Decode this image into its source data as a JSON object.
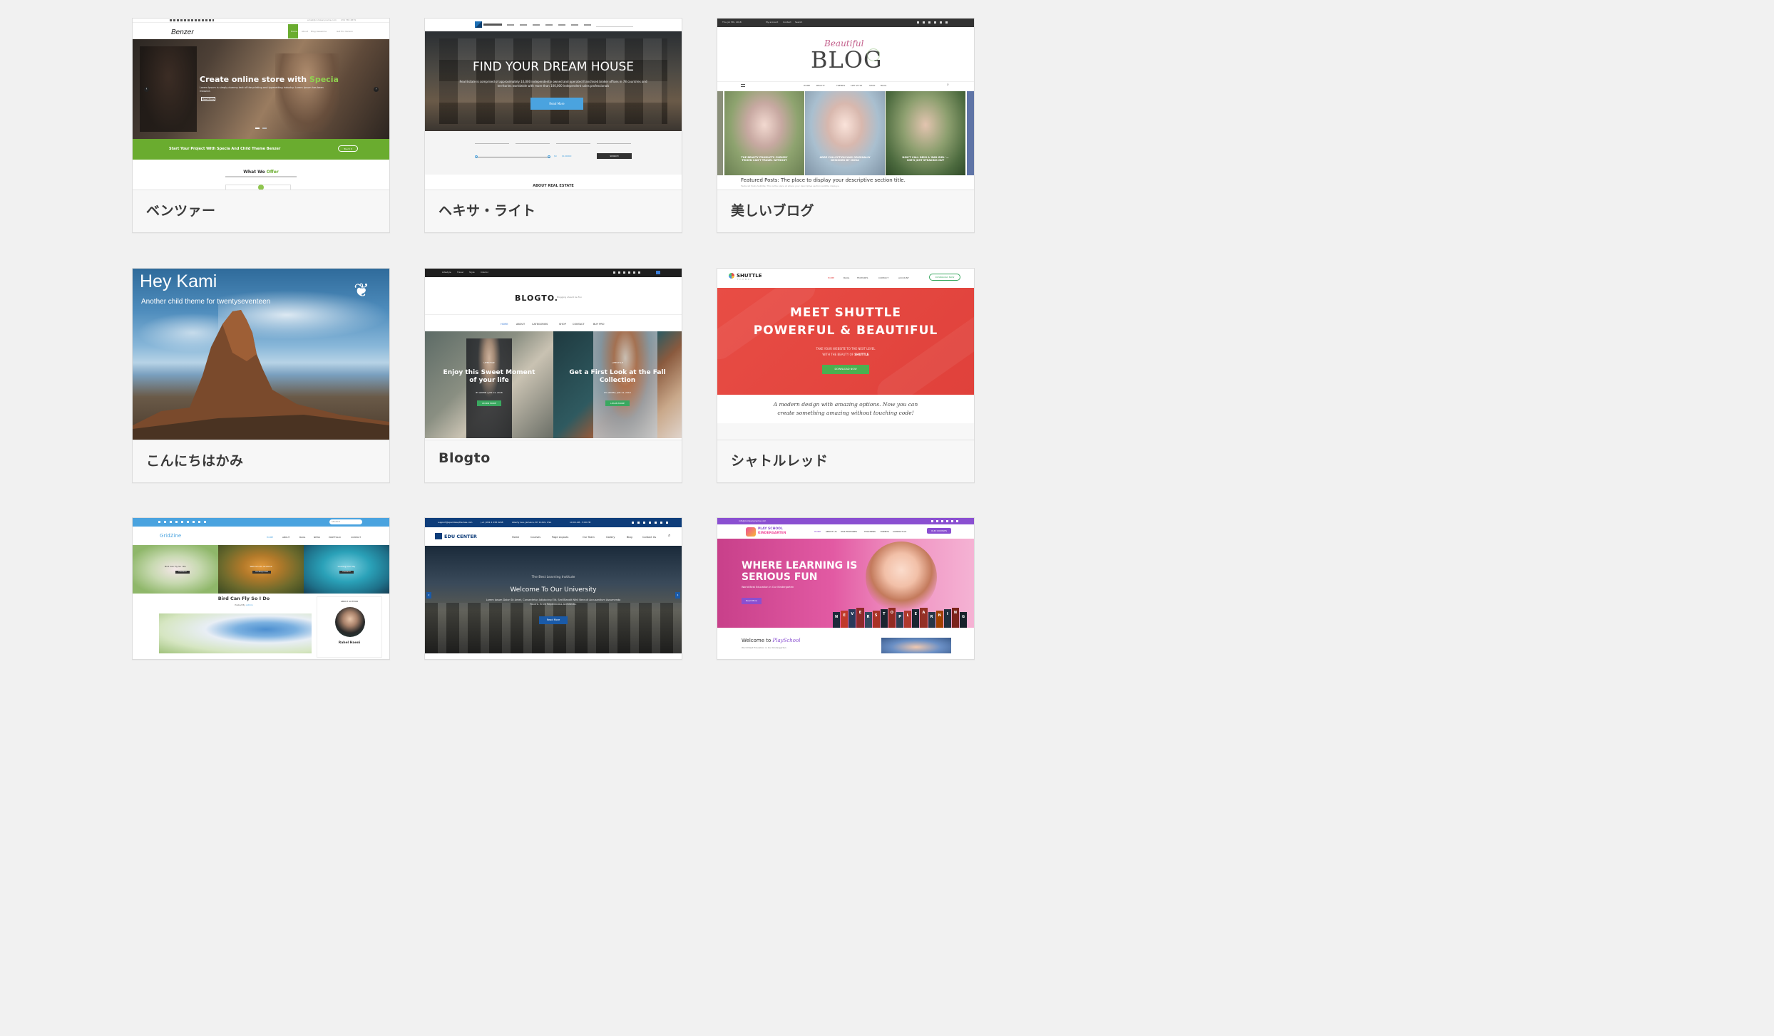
{
  "themes": [
    {
      "name": "ベンツァー",
      "preview": {
        "logo": "Benzer",
        "headline_prefix": "Create online store with ",
        "headline_accent": "Specia",
        "tagline": "Lorem Ipsum is simply dummy text of the printing and typesetting industry. Lorem Ipsum has been massive.",
        "slide_button": "Read More",
        "cta_text": "Start Your Project With Specia And Child Theme Benzer",
        "cta_button": "Touch it",
        "section_title": "What We ",
        "section_accent": "Offer",
        "nav": [
          "Home",
          "About",
          "Blog Awesome",
          "Get Pro Version"
        ],
        "email": "email@companyname.com",
        "phone": "234 765 4879"
      }
    },
    {
      "name": "ヘキサ・ライト",
      "preview": {
        "headline": "FIND YOUR DREAM HOUSE",
        "subtext": "Real Estate is comprised of approximately 10,000 independently owned and operated franchised broker offices in 78 countries and territories worldwide with more than 100,000 independent sales professionals",
        "button": "Read More",
        "footer": "ABOUT REAL ESTATE",
        "search_button": "SEARCH",
        "price_min": "$0",
        "price_max": "$100000"
      }
    },
    {
      "name": "美しいブログ",
      "preview": {
        "top_links": [
          "Thu, Jul 5th, 2018",
          "My account",
          "Contact",
          "Search"
        ],
        "logo_script": "Beautiful",
        "logo": "BLOG",
        "nav": [
          "HOME",
          "BEAUTY",
          "TRENDS",
          "LIFE STYLE",
          "SHOP",
          "BLOG"
        ],
        "posts": [
          "THE BEAUTY PRODUCTS CHRISSY TEIGEN CAN'T TRAVEL WITHOUT",
          "ADRE COLLECTION WAS ORIGINALLY DESIGNED BY ISKRA",
          "DON'T CALL DEMI A 'BAD GIRL' — SHE'S JUST SPEAKING OUT"
        ],
        "featured": "Featured Posts: The place to display your descriptive section title.",
        "featured_sub": "Featured Posts Subtitle: This is the place at where your descriptive section subtitle displays."
      }
    },
    {
      "name": "こんにちはかみ",
      "preview": {
        "title": "Hey Kami",
        "subtitle": "Another child theme for twentyseventeen"
      }
    },
    {
      "name": "Blogto",
      "preview": {
        "top_nav": [
          "Lifestyle",
          "Travel",
          "Style",
          "Interior"
        ],
        "logo": "BLOGTO.",
        "tagline": "Blogging should be Fun",
        "nav": [
          "HOME",
          "ABOUT",
          "CATEGORIES",
          "SHOP",
          "CONTACT",
          "BUY PRO"
        ],
        "post1": "Enjoy this Sweet Moment of your life",
        "post2": "Get a First Look at the Fall Collection",
        "post_button": "LEARN MORE",
        "post_cat": "LIFESTYLE",
        "post_meta": "BY ADMIN / JUN 14, 2018"
      }
    },
    {
      "name": "シャトルレッド",
      "preview": {
        "logo": "SHUTTLE",
        "logo_sub": "THEMES",
        "nav": [
          "HOME",
          "BLOG",
          "FEATURES",
          "CONTACT",
          "ACCOUNT"
        ],
        "download": "DOWNLOAD NOW",
        "headline1": "MEET SHUTTLE",
        "headline2": "POWERFUL & BEAUTIFUL",
        "sub1": "TAKE YOUR WEBSITE TO THE NEXT LEVEL",
        "sub2_prefix": "WITH THE BEAUTY OF ",
        "sub2_accent": "SHUTTLE",
        "button": "DOWNLOAD NOW",
        "quote": "A modern design with amazing options. Now you can create something amazing without touching code!"
      }
    },
    {
      "name": "",
      "preview": {
        "logo": "GridZine",
        "nav": [
          "HOME",
          "ABOUT",
          "BLOG",
          "NEWS",
          "PORTFOLIO",
          "CONTACT"
        ],
        "search": "SEARCH",
        "slides": [
          "Bird Can Fly So I Do",
          "Welcome to Gridzine",
          "Looking Into Sky"
        ],
        "badge1": "Featured",
        "badge2": "Uncategorized",
        "post_title": "Bird Can Fly So I Do",
        "post_meta": "Posted By ",
        "post_author": "Admin",
        "about": "ABOUT AUTHOR",
        "author": "Rahel Haeni"
      }
    },
    {
      "name": "",
      "preview": {
        "email": "support@sparklewpthemes.com",
        "phone": "(+1) 952 4 238 0248",
        "address": "Liberty Ave, Jamaica, NY 11419, USA",
        "hours": "10:00 AM - 5:00 PM",
        "logo": "EDU CENTER",
        "nav": [
          "Home",
          "Courses",
          "Page Layouts",
          "Our Team",
          "Gallery",
          "Blog",
          "Contact Us"
        ],
        "kicker": "The Best Learning Institute",
        "headline": "Welcome To Our University",
        "text": "Lorem Ipsum Dolor Sit Amet, Consectetur Adipiscing Elit. Sed Blandit Nihil Necruit Accusantium Assumenda Facere. Enim Repellendus Architecto.",
        "button": "Read More"
      }
    },
    {
      "name": "",
      "preview": {
        "topbar": "info@companyname.com",
        "logo_line1": "PLAY SCHOOL",
        "logo_line2": "KINDERGARTEN",
        "nav": [
          "HOME",
          "ABOUT US",
          "OUR FEATURES",
          "TEACHERS",
          "EVENTS",
          "CONTACT US"
        ],
        "courses": "OUR COURSES",
        "headline1": "WHERE LEARNING IS",
        "headline2": "SERIOUS FUN",
        "sub": "World Best Education in Our Kindergarten",
        "button": "Read More",
        "letters": [
          "N",
          "E",
          "V",
          "E",
          "R",
          "S",
          "T",
          "O",
          "P",
          "L",
          "E",
          "A",
          "R",
          "N",
          "I",
          "N",
          "G"
        ],
        "welcome": "Welcome to ",
        "welcome_script": "PlaySchool",
        "welcome_sub": "World Best Education in Our Kindergarten"
      }
    }
  ]
}
